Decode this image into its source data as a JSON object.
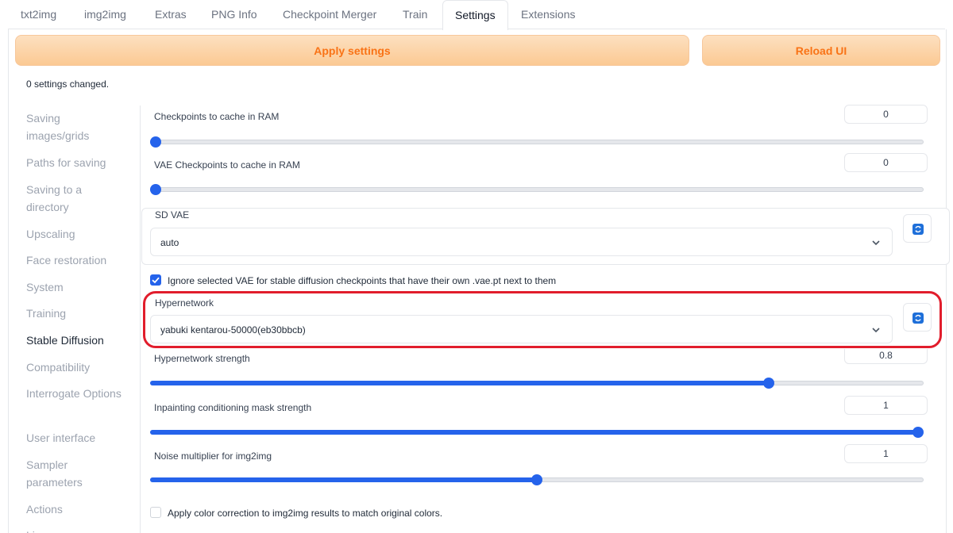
{
  "tabs": [
    {
      "label": "txt2img"
    },
    {
      "label": "img2img"
    },
    {
      "label": "Extras"
    },
    {
      "label": "PNG Info"
    },
    {
      "label": "Checkpoint Merger"
    },
    {
      "label": "Train"
    },
    {
      "label": "Settings"
    },
    {
      "label": "Extensions"
    }
  ],
  "active_tab": "Settings",
  "toolbar": {
    "apply_label": "Apply settings",
    "reload_label": "Reload UI"
  },
  "status": "0 settings changed.",
  "sidebar": {
    "items": [
      {
        "label": "Saving images/grids"
      },
      {
        "label": "Paths for saving"
      },
      {
        "label": "Saving to a directory"
      },
      {
        "label": "Upscaling"
      },
      {
        "label": "Face restoration"
      },
      {
        "label": "System"
      },
      {
        "label": "Training"
      },
      {
        "label": "Stable Diffusion"
      },
      {
        "label": "Compatibility"
      },
      {
        "label": "Interrogate Options"
      },
      {
        "label": "User interface"
      },
      {
        "label": "Sampler parameters"
      },
      {
        "label": "Actions"
      },
      {
        "label": "Licenses"
      }
    ],
    "active": "Stable Diffusion"
  },
  "settings": {
    "checkpoints_cache": {
      "label": "Checkpoints to cache in RAM",
      "value": "0",
      "fraction": 0.0
    },
    "vae_checkpoints_cache": {
      "label": "VAE Checkpoints to cache in RAM",
      "value": "0",
      "fraction": 0.0
    },
    "sd_vae": {
      "label": "SD VAE",
      "value": "auto"
    },
    "ignore_vae": {
      "label": "Ignore selected VAE for stable diffusion checkpoints that have their own .vae.pt next to them",
      "checked": true
    },
    "hypernetwork": {
      "label": "Hypernetwork",
      "value": "yabuki kentarou-50000(eb30bbcb)"
    },
    "hypernetwork_strength": {
      "label": "Hypernetwork strength",
      "value": "0.8",
      "fraction": 0.8
    },
    "inpainting_mask_strength": {
      "label": "Inpainting conditioning mask strength",
      "value": "1",
      "fraction": 1.0
    },
    "noise_multiplier": {
      "label": "Noise multiplier for img2img",
      "value": "1",
      "fraction": 0.5
    },
    "color_correction": {
      "label": "Apply color correction to img2img results to match original colors.",
      "checked": false
    }
  },
  "colors": {
    "accent": "#2563eb",
    "button_text": "#f97316",
    "highlight": "#e11d2c"
  }
}
